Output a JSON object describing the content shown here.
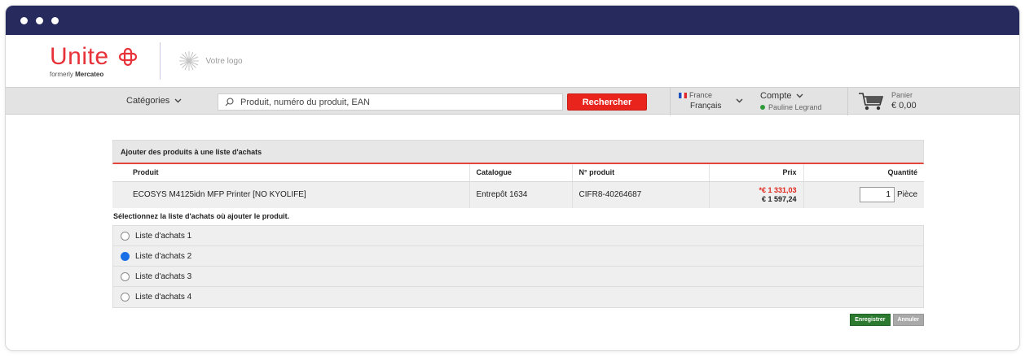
{
  "window": {
    "dots": 3
  },
  "brand": {
    "name": "Unite",
    "formerly_prefix": "formerly",
    "formerly_name": "Mercateo",
    "partner_logo_text": "Votre logo",
    "accent": "#e8323a"
  },
  "nav": {
    "categories_label": "Catégories",
    "search_placeholder": "Produit, numéro du produit, EAN",
    "search_button": "Rechercher",
    "country": "France",
    "language": "Français",
    "account_label": "Compte",
    "user_name": "Pauline Legrand",
    "cart_label": "Panier",
    "cart_total": "€ 0,00"
  },
  "dialog": {
    "title": "Ajouter des produits à une liste d'achats",
    "columns": {
      "product": "Produit",
      "catalog": "Catalogue",
      "number": "N° produit",
      "price": "Prix",
      "quantity": "Quantité"
    },
    "item": {
      "product": "ECOSYS M4125idn MFP Printer [NO KYOLIFE]",
      "catalog": "Entrepôt 1634",
      "number": "CIFR8-40264687",
      "price_net": "*€ 1 331,03",
      "price_gross": "€ 1 597,24",
      "quantity": "1",
      "unit": "Pièce"
    },
    "choose_label": "Sélectionnez la liste d'achats où ajouter le produit.",
    "lists": [
      "Liste d'achats 1",
      "Liste d'achats 2",
      "Liste d'achats 3",
      "Liste d'achats 4"
    ],
    "selected_list": "Liste d'achats 2",
    "save_button": "Enregistrer",
    "cancel_button": "Annuler"
  },
  "colors": {
    "titlebar": "#262a5c",
    "search_button": "#e8241c",
    "save_button": "#2b7a30",
    "radio_selected": "#1a6fe6"
  }
}
